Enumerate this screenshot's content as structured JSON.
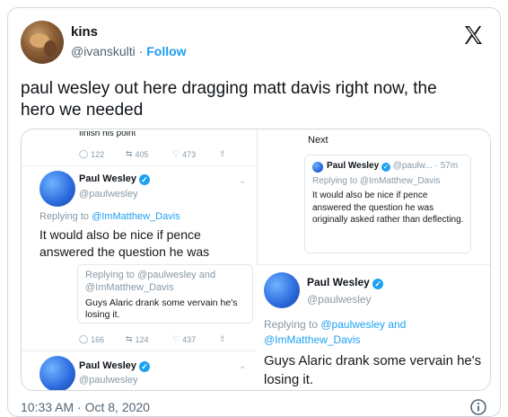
{
  "author": {
    "name": "kins",
    "handle": "@ivanskulti",
    "separator": "·",
    "follow_label": "Follow"
  },
  "tweet": {
    "text": "paul wesley out here dragging matt davis right now, the hero we needed",
    "timestamp": "10:33 AM · Oct 8, 2020"
  },
  "screenshot": {
    "left": {
      "top_partial": "finish his point",
      "top_actions": {
        "replies": "122",
        "retweets": "405",
        "likes": "473"
      },
      "main": {
        "name": "Paul Wesley",
        "handle": "@paulwesley",
        "replying": "Replying to ",
        "replying_to": "@ImMatthew_Davis",
        "text": "It would also be nice if pence answered the question he was"
      },
      "reply_box": {
        "replying_line1_to": "@paulwesley",
        "replying_line1_prefix": "Replying to ",
        "replying_line1_suffix": " and",
        "replying_line2": "@ImMatthew_Davis",
        "text": "Guys Alaric drank some vervain he's losing it."
      },
      "bottom_actions": {
        "replies": "166",
        "retweets": "124",
        "likes": "437"
      },
      "bottom_user": {
        "name": "Paul Wesley",
        "handle": "@paulwesley"
      }
    },
    "right": {
      "next_label": "Next",
      "card": {
        "name": "Paul Wesley",
        "handle": "@paulw...",
        "time": "· 57m",
        "replying": "Replying to ",
        "replying_to": "@ImMatthew_Davis",
        "text": "It would also be nice if pence answered the question he was originally asked rather than deflecting."
      }
    },
    "overlay": {
      "name": "Paul Wesley",
      "handle": "@paulwesley",
      "replying_prefix": "Replying to ",
      "replying_to1": "@paulwesley",
      "replying_and": " and",
      "replying_to2": "@ImMatthew_Davis",
      "text": "Guys Alaric drank some vervain he's losing it."
    }
  },
  "icons": [
    "x-logo-icon",
    "verified-icon",
    "reply-icon",
    "retweet-icon",
    "like-icon",
    "share-icon",
    "chevron-down-icon",
    "info-icon"
  ],
  "colors": {
    "link": "#1d9bf0",
    "verified": "#1da1f2",
    "muted": "#536471"
  }
}
